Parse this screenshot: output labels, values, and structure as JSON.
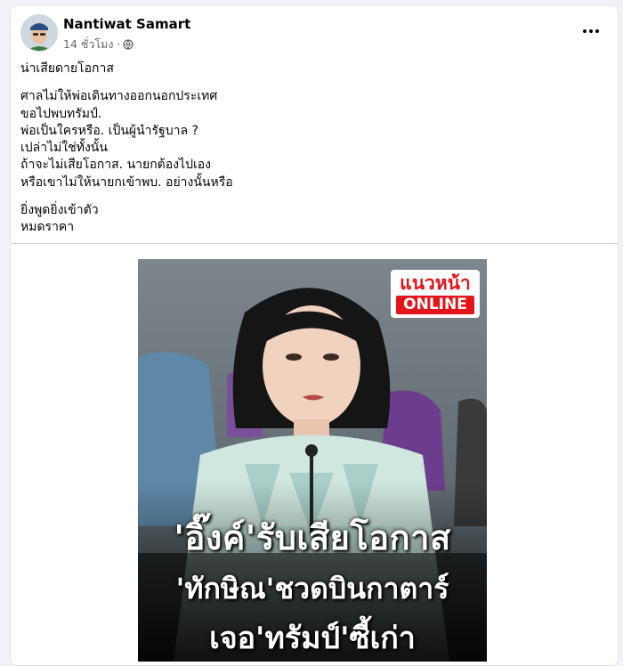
{
  "post": {
    "author": "Nantiwat Samart",
    "time": "14 ชั่วโมง ·",
    "privacy_icon": "globe-icon",
    "menu_icon": "more-options-icon",
    "paragraphs": [
      [
        "น่าเสียดายโอกาส"
      ],
      [
        "ศาลไม่ให้พ่อเดินทางออกนอกประเทศ",
        "ขอไปพบทรัมป์.",
        "พ่อเป็นใครหรือ. เป็นผู้นำรัฐบาล ?",
        "เปล่าไม่ใช่ทั้งนั้น",
        "ถ้าจะไม่เสียโอกาส. นายกต้องไปเอง",
        "หรือเขาไม่ให้นายกเข้าพบ. อย่างนั้นหรือ"
      ],
      [
        "ยิ่งพูดยิ่งเข้าตัว",
        "หมดราคา"
      ]
    ]
  },
  "image": {
    "logo_line1": "แนวหน้า",
    "logo_line2": "ONLINE",
    "headline_1": "'อิ๊งค์'รับเสียโอกาส",
    "headline_2": "'ทักษิณ'ชวดบินกาตาร์",
    "headline_3": "เจอ'ทรัมป์'ซี้เก่า"
  },
  "colors": {
    "brand_red": "#e3151b",
    "text": "#050505",
    "secondary_text": "#65676b"
  }
}
